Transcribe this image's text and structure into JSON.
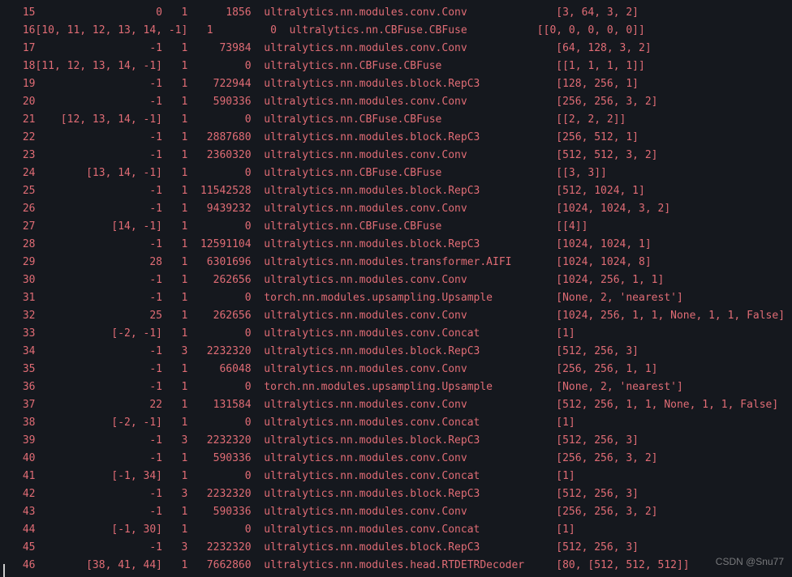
{
  "watermark": "CSDN @Snu77",
  "cols": {
    "idx_width": 3,
    "from_width": 20,
    "n_width": 4,
    "params_width": 10,
    "module_width": 46
  },
  "rows": [
    {
      "idx": 15,
      "from": "0",
      "n": 1,
      "params": 1856,
      "module": "ultralytics.nn.modules.conv.Conv",
      "args": "[3, 64, 3, 2]"
    },
    {
      "idx": 16,
      "from": "[10, 11, 12, 13, 14, -1]",
      "n": 1,
      "params": 0,
      "module": "ultralytics.nn.CBFuse.CBFuse",
      "args": "[[0, 0, 0, 0, 0]]",
      "args_space": "           "
    },
    {
      "idx": 17,
      "from": "-1",
      "n": 1,
      "params": 73984,
      "module": "ultralytics.nn.modules.conv.Conv",
      "args": "[64, 128, 3, 2]"
    },
    {
      "idx": 18,
      "from": "[11, 12, 13, 14, -1]",
      "n": 1,
      "params": 0,
      "module": "ultralytics.nn.CBFuse.CBFuse",
      "args": "[[1, 1, 1, 1]]"
    },
    {
      "idx": 19,
      "from": "-1",
      "n": 1,
      "params": 722944,
      "module": "ultralytics.nn.modules.block.RepC3",
      "args": "[128, 256, 1]"
    },
    {
      "idx": 20,
      "from": "-1",
      "n": 1,
      "params": 590336,
      "module": "ultralytics.nn.modules.conv.Conv",
      "args": "[256, 256, 3, 2]"
    },
    {
      "idx": 21,
      "from": "[12, 13, 14, -1]",
      "n": 1,
      "params": 0,
      "module": "ultralytics.nn.CBFuse.CBFuse",
      "args": "[[2, 2, 2]]"
    },
    {
      "idx": 22,
      "from": "-1",
      "n": 1,
      "params": 2887680,
      "module": "ultralytics.nn.modules.block.RepC3",
      "args": "[256, 512, 1]"
    },
    {
      "idx": 23,
      "from": "-1",
      "n": 1,
      "params": 2360320,
      "module": "ultralytics.nn.modules.conv.Conv",
      "args": "[512, 512, 3, 2]"
    },
    {
      "idx": 24,
      "from": "[13, 14, -1]",
      "n": 1,
      "params": 0,
      "module": "ultralytics.nn.CBFuse.CBFuse",
      "args": "[[3, 3]]"
    },
    {
      "idx": 25,
      "from": "-1",
      "n": 1,
      "params": 11542528,
      "module": "ultralytics.nn.modules.block.RepC3",
      "args": "[512, 1024, 1]"
    },
    {
      "idx": 26,
      "from": "-1",
      "n": 1,
      "params": 9439232,
      "module": "ultralytics.nn.modules.conv.Conv",
      "args": "[1024, 1024, 3, 2]"
    },
    {
      "idx": 27,
      "from": "[14, -1]",
      "n": 1,
      "params": 0,
      "module": "ultralytics.nn.CBFuse.CBFuse",
      "args": "[[4]]"
    },
    {
      "idx": 28,
      "from": "-1",
      "n": 1,
      "params": 12591104,
      "module": "ultralytics.nn.modules.block.RepC3",
      "args": "[1024, 1024, 1]"
    },
    {
      "idx": 29,
      "from": "28",
      "n": 1,
      "params": 6301696,
      "module": "ultralytics.nn.modules.transformer.AIFI",
      "args": "[1024, 1024, 8]"
    },
    {
      "idx": 30,
      "from": "-1",
      "n": 1,
      "params": 262656,
      "module": "ultralytics.nn.modules.conv.Conv",
      "args": "[1024, 256, 1, 1]"
    },
    {
      "idx": 31,
      "from": "-1",
      "n": 1,
      "params": 0,
      "module": "torch.nn.modules.upsampling.Upsample",
      "args": "[None, 2, 'nearest']"
    },
    {
      "idx": 32,
      "from": "25",
      "n": 1,
      "params": 262656,
      "module": "ultralytics.nn.modules.conv.Conv",
      "args": "[1024, 256, 1, 1, None, 1, 1, False]"
    },
    {
      "idx": 33,
      "from": "[-2, -1]",
      "n": 1,
      "params": 0,
      "module": "ultralytics.nn.modules.conv.Concat",
      "args": "[1]"
    },
    {
      "idx": 34,
      "from": "-1",
      "n": 3,
      "params": 2232320,
      "module": "ultralytics.nn.modules.block.RepC3",
      "args": "[512, 256, 3]"
    },
    {
      "idx": 35,
      "from": "-1",
      "n": 1,
      "params": 66048,
      "module": "ultralytics.nn.modules.conv.Conv",
      "args": "[256, 256, 1, 1]"
    },
    {
      "idx": 36,
      "from": "-1",
      "n": 1,
      "params": 0,
      "module": "torch.nn.modules.upsampling.Upsample",
      "args": "[None, 2, 'nearest']"
    },
    {
      "idx": 37,
      "from": "22",
      "n": 1,
      "params": 131584,
      "module": "ultralytics.nn.modules.conv.Conv",
      "args": "[512, 256, 1, 1, None, 1, 1, False]"
    },
    {
      "idx": 38,
      "from": "[-2, -1]",
      "n": 1,
      "params": 0,
      "module": "ultralytics.nn.modules.conv.Concat",
      "args": "[1]"
    },
    {
      "idx": 39,
      "from": "-1",
      "n": 3,
      "params": 2232320,
      "module": "ultralytics.nn.modules.block.RepC3",
      "args": "[512, 256, 3]"
    },
    {
      "idx": 40,
      "from": "-1",
      "n": 1,
      "params": 590336,
      "module": "ultralytics.nn.modules.conv.Conv",
      "args": "[256, 256, 3, 2]"
    },
    {
      "idx": 41,
      "from": "[-1, 34]",
      "n": 1,
      "params": 0,
      "module": "ultralytics.nn.modules.conv.Concat",
      "args": "[1]"
    },
    {
      "idx": 42,
      "from": "-1",
      "n": 3,
      "params": 2232320,
      "module": "ultralytics.nn.modules.block.RepC3",
      "args": "[512, 256, 3]"
    },
    {
      "idx": 43,
      "from": "-1",
      "n": 1,
      "params": 590336,
      "module": "ultralytics.nn.modules.conv.Conv",
      "args": "[256, 256, 3, 2]"
    },
    {
      "idx": 44,
      "from": "[-1, 30]",
      "n": 1,
      "params": 0,
      "module": "ultralytics.nn.modules.conv.Concat",
      "args": "[1]"
    },
    {
      "idx": 45,
      "from": "-1",
      "n": 3,
      "params": 2232320,
      "module": "ultralytics.nn.modules.block.RepC3",
      "args": "[512, 256, 3]"
    },
    {
      "idx": 46,
      "from": "[38, 41, 44]",
      "n": 1,
      "params": 7662860,
      "module": "ultralytics.nn.modules.head.RTDETRDecoder",
      "args": "[80, [512, 512, 512]]"
    }
  ]
}
